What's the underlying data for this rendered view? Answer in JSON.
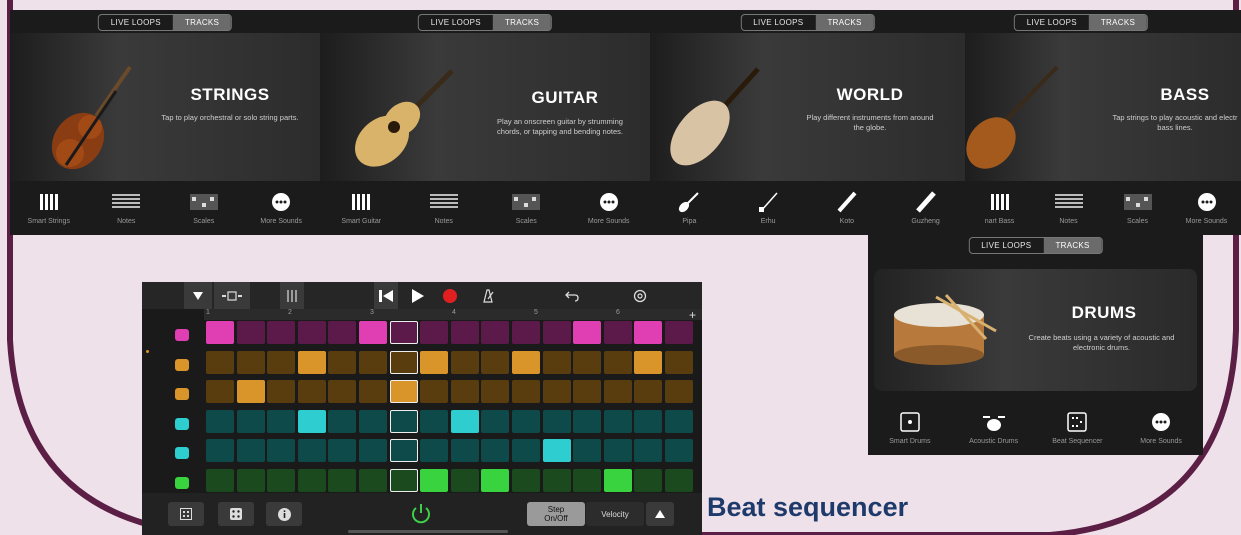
{
  "segmented": {
    "live_loops": "LIVE LOOPS",
    "tracks": "TRACKS"
  },
  "panels": {
    "strings": {
      "title": "STRINGS",
      "description": "Tap to play orchestral or solo string parts.",
      "options": [
        "Smart Strings",
        "Notes",
        "Scales",
        "More Sounds"
      ]
    },
    "guitar": {
      "title": "GUITAR",
      "description_lines": [
        "Play an onscreen guitar by strumming",
        "chords, or tapping and bending notes."
      ],
      "options": [
        "Smart Guitar",
        "Notes",
        "Scales",
        "More Sounds"
      ]
    },
    "world": {
      "title": "WORLD",
      "description_lines": [
        "Play different instruments from around",
        "the globe."
      ],
      "options": [
        "Pipa",
        "Erhu",
        "Koto",
        "Guzheng"
      ]
    },
    "bass": {
      "title": "BASS",
      "description_lines": [
        "Tap strings to play acoustic and electr",
        "bass lines."
      ],
      "options": [
        "nart Bass",
        "Notes",
        "Scales",
        "More Sounds"
      ]
    },
    "drums": {
      "title": "DRUMS",
      "description_lines": [
        "Create beats using a variety of acoustic and",
        "electronic drums."
      ],
      "options": [
        "Smart Drums",
        "Acoustic Drums",
        "Beat Sequencer",
        "More Sounds"
      ]
    }
  },
  "sequencer": {
    "ruler_marks": [
      "1",
      "2",
      "3",
      "4",
      "5",
      "6"
    ],
    "step_label_1": "Step",
    "step_label_2": "On/Off",
    "velocity_label": "Velocity",
    "rows": [
      {
        "icon": "crash-cymbal-icon",
        "color": "#5c1a4a",
        "active_color": "#e03fb4",
        "active": [
          0,
          5,
          12,
          14
        ]
      },
      {
        "icon": "snare-drum-icon",
        "color": "#5a3d0f",
        "active_color": "#d9952a",
        "active": [
          3,
          7,
          10,
          14
        ]
      },
      {
        "icon": "clap-hand-icon",
        "color": "#5a3d0f",
        "active_color": "#d9952a",
        "active": [
          1,
          6
        ]
      },
      {
        "icon": "hi-hat-icon",
        "color": "#0f4a4a",
        "active_color": "#2dcdd0",
        "active": [
          3,
          8
        ]
      },
      {
        "icon": "hi-hat-open-icon",
        "color": "#0f4a4a",
        "active_color": "#2dcdd0",
        "active": [
          11
        ]
      },
      {
        "icon": "kick-drum-icon",
        "color": "#1b4a1e",
        "active_color": "#38d33f",
        "active": [
          7,
          9,
          13
        ]
      }
    ]
  },
  "caption": "Beat sequencer"
}
